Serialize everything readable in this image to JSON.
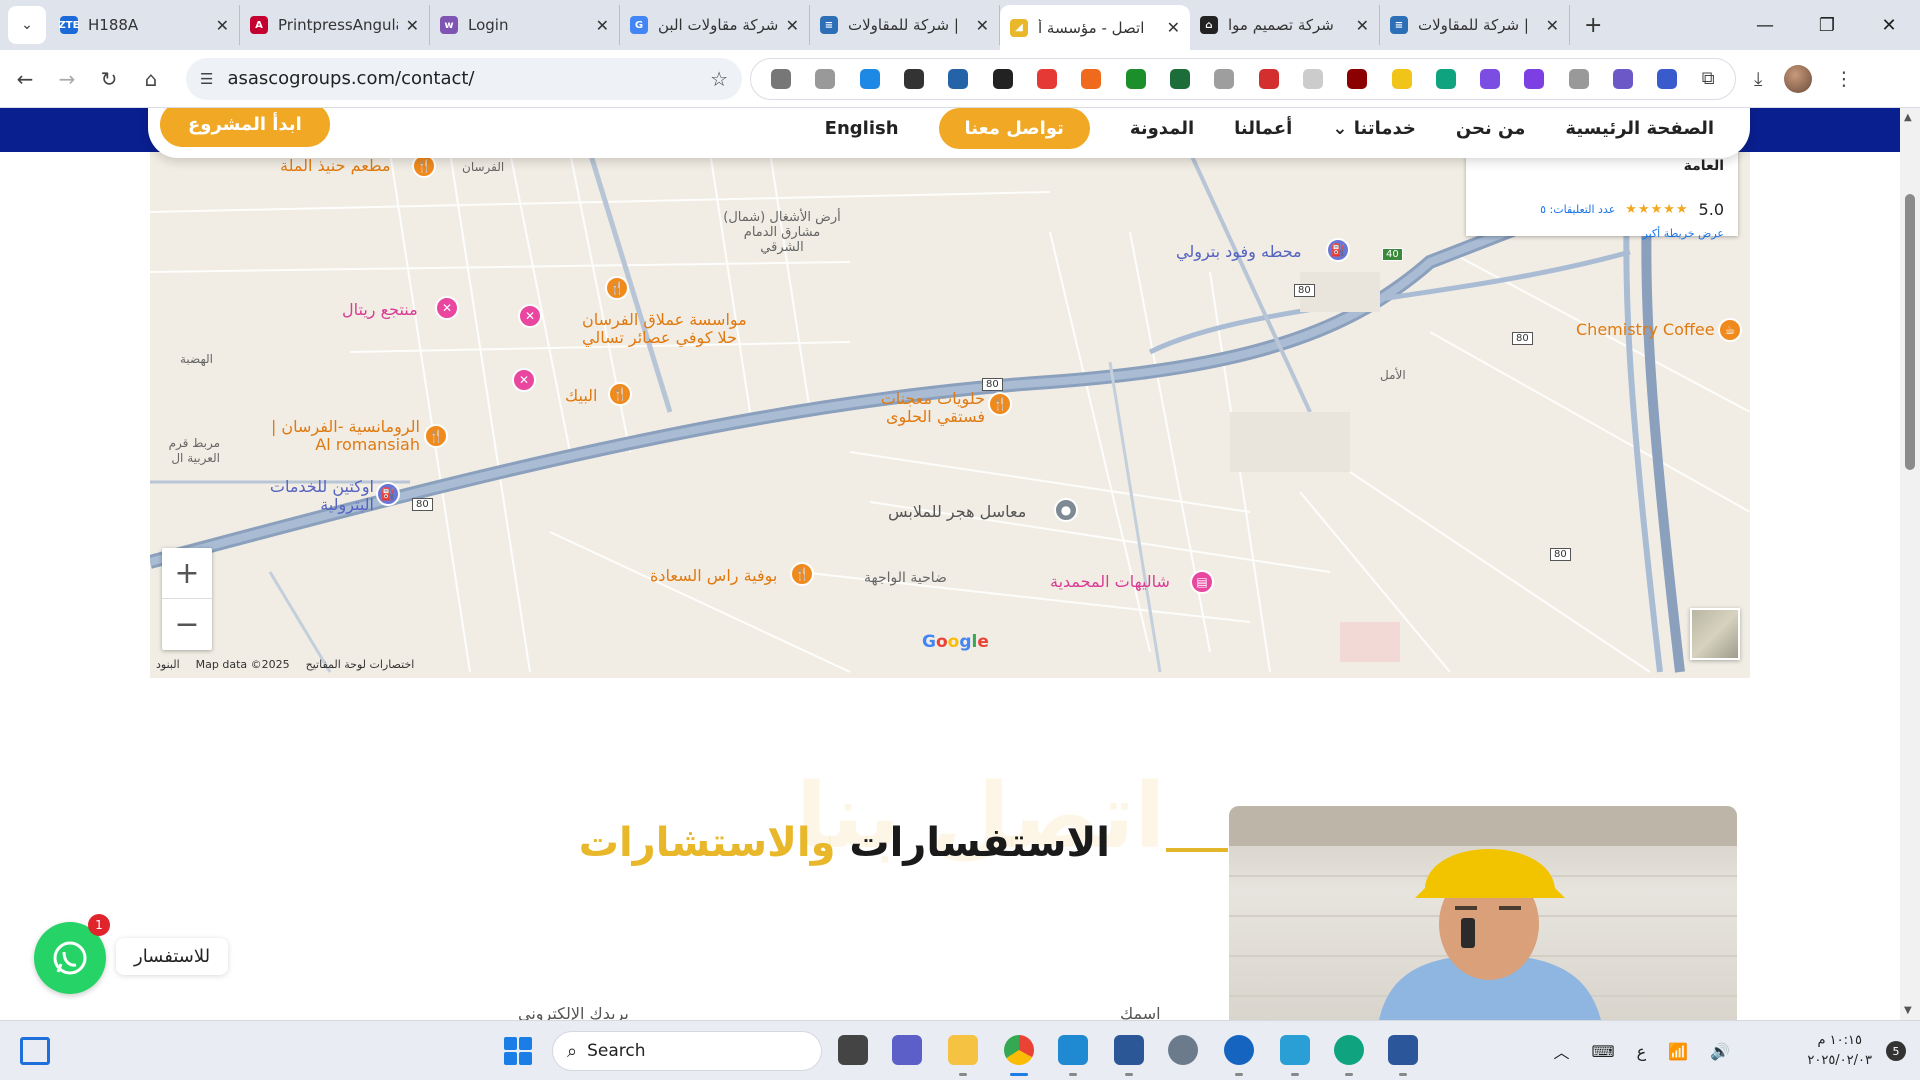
{
  "browser": {
    "tabs": [
      {
        "title": "H188A",
        "favicon": "zte-logo",
        "favicon_text": "ZTE",
        "favicon_color": "#1b6ad7"
      },
      {
        "title": "PrintpressAngular",
        "favicon": "angular-logo",
        "favicon_text": "A",
        "favicon_color": "#c3002f"
      },
      {
        "title": "Login",
        "favicon": "woo-logo",
        "favicon_text": "w",
        "favicon_color": "#7f54b3"
      },
      {
        "title": "شركة مقاولات البن",
        "favicon": "google-logo",
        "favicon_text": "G",
        "favicon_color": "#4285f4"
      },
      {
        "title": "شركة للمقاولات |",
        "favicon": "site-logo",
        "favicon_text": "≡",
        "favicon_color": "#2d6fb7"
      },
      {
        "title": "اتصل - مؤسسة أ",
        "favicon": "site-logo",
        "favicon_text": "◢",
        "favicon_color": "#e8b72a",
        "active": true
      },
      {
        "title": "شركة تصميم موا",
        "favicon": "house-logo",
        "favicon_text": "⌂",
        "favicon_color": "#222222"
      },
      {
        "title": "شركة للمقاولات |",
        "favicon": "site-logo",
        "favicon_text": "≡",
        "favicon_color": "#2d6fb7"
      }
    ],
    "url": "asascogroups.com/contact/",
    "extension_colors": [
      "#777777",
      "#999999",
      "#1e88e5",
      "#333333",
      "#2563a8",
      "#222222",
      "#e53935",
      "#f06a1d",
      "#1d8f2a",
      "#1d6d3a",
      "#9e9e9e",
      "#d32f2f",
      "#cccccc",
      "#8b0000",
      "#f0c419",
      "#10a37f",
      "#7b4de2",
      "#7b3fe4",
      "#999999",
      "#6d58c8",
      "#3a5bcc"
    ]
  },
  "site": {
    "nav": {
      "home": "الصفحة الرئيسية",
      "about": "من نحن",
      "services": "خدماتنا",
      "works": "أعمالنا",
      "blog": "المدونة",
      "contact": "تواصل معنا",
      "english": "English",
      "start": "ابدأ المشروع"
    },
    "map": {
      "infocard": {
        "rating": "5.0",
        "reviews": "عدد التعليقات: ٥",
        "bigger_map": "عرض خريطة أكبر",
        "cut_title": "أسس الخليج للتجارة والمقاولات العامة"
      },
      "pois": [
        {
          "name": "مطعم حنيذ الملة",
          "kind": "restaurant"
        },
        {
          "name": "منتجع ريتال",
          "kind": "resort"
        },
        {
          "name": "مواسسة عملاق الفرسان",
          "kind": "business"
        },
        {
          "name": "حلا كوفي عصائر تسالي",
          "kind": "restaurant"
        },
        {
          "name": "البيك",
          "kind": "restaurant"
        },
        {
          "name": "الرومانسية -الفرسان | Al romansiah",
          "kind": "restaurant"
        },
        {
          "name": "اوكتين للخدمات البترولية",
          "kind": "fuel"
        },
        {
          "name": "حلويات معجنات فستقي الحلوى",
          "kind": "restaurant"
        },
        {
          "name": "معاسل هجر للملابس",
          "kind": "laundry"
        },
        {
          "name": "بوفية راس السعادة",
          "kind": "restaurant"
        },
        {
          "name": "شاليهات المحمدية",
          "kind": "resort"
        },
        {
          "name": "محطه وفود بترولي",
          "kind": "fuel"
        },
        {
          "name": "Chemistry Coffee",
          "kind": "restaurant"
        }
      ],
      "area_labels": {
        "faisan": "الفرسان",
        "projects": "أرض الأشغال (شمال) مشارق الدمام الشرقي",
        "hadba": "الهضبة",
        "amal": "الأمل",
        "wajha": "ضاحية الواجهة",
        "arab_box": "مربط قرم العربية ال"
      },
      "road_shields": [
        "80",
        "80",
        "80",
        "80",
        "80",
        "40"
      ],
      "footer_terms": "البنود",
      "footer_data": "Map data ©2025",
      "footer_shortcuts": "اختصارات لوحة المفاتيح",
      "google": "Google"
    },
    "contact": {
      "heading_dark": "الاستفسارات",
      "heading_gold": "والاستشارات",
      "ghost_text": "اتصل بنا",
      "label_name": "اسمك",
      "label_email": "بريدك الإلكتروني"
    },
    "whatsapp": {
      "label": "للاستفسار",
      "badge": "1"
    }
  },
  "taskbar": {
    "search_placeholder": "Search",
    "time": "١٠:١٥ م",
    "date": "٢٠٢٥/٠٢/٠٣",
    "notifications": "5",
    "lang": "ع"
  }
}
